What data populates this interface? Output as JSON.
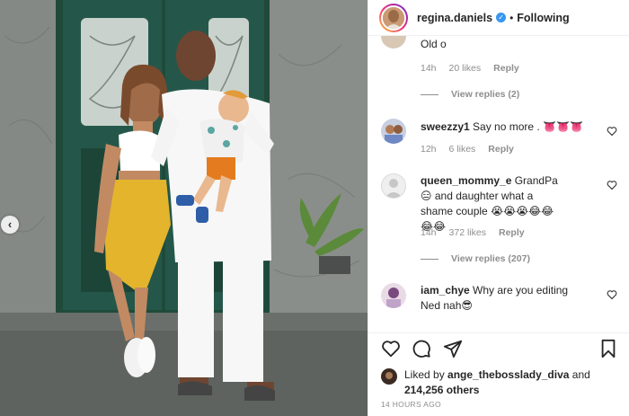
{
  "post": {
    "username": "regina.daniels",
    "dot": "•",
    "follow_state": "Following",
    "verified_badge": "✓",
    "prev_arrow": "‹"
  },
  "comments": {
    "cut_text": "Old o",
    "first_meta": {
      "time": "14h",
      "likes": "20 likes",
      "reply": "Reply"
    },
    "first_view_replies": "View replies (2)",
    "items": [
      {
        "user": "sweezzy1",
        "text": "Say no more .",
        "emoji": "👅👅👅",
        "time": "12h",
        "likes": "6 likes",
        "reply": "Reply"
      },
      {
        "user": "queen_mommy_e",
        "text": "GrandPa",
        "text_emoji": "😑",
        "text2": "and daughter what a shame couple",
        "emoji": "😭😭😭😂😂😂😂",
        "time": "14h",
        "likes": "372 likes",
        "reply": "Reply",
        "view_replies": "View replies (207)"
      },
      {
        "user": "iam_chye",
        "text": "Why are you editing Ned nah",
        "emoji": "😎"
      }
    ]
  },
  "actions": {
    "liked_by_prefix": "Liked by",
    "liked_by_user": "ange_thebosslady_diva",
    "and": "and",
    "others": "214,256 others",
    "timestamp": "14 HOURS AGO"
  },
  "icons": [
    "verified-icon",
    "heart-icon",
    "comment-icon",
    "share-icon",
    "bookmark-icon",
    "chevron-left-icon"
  ]
}
